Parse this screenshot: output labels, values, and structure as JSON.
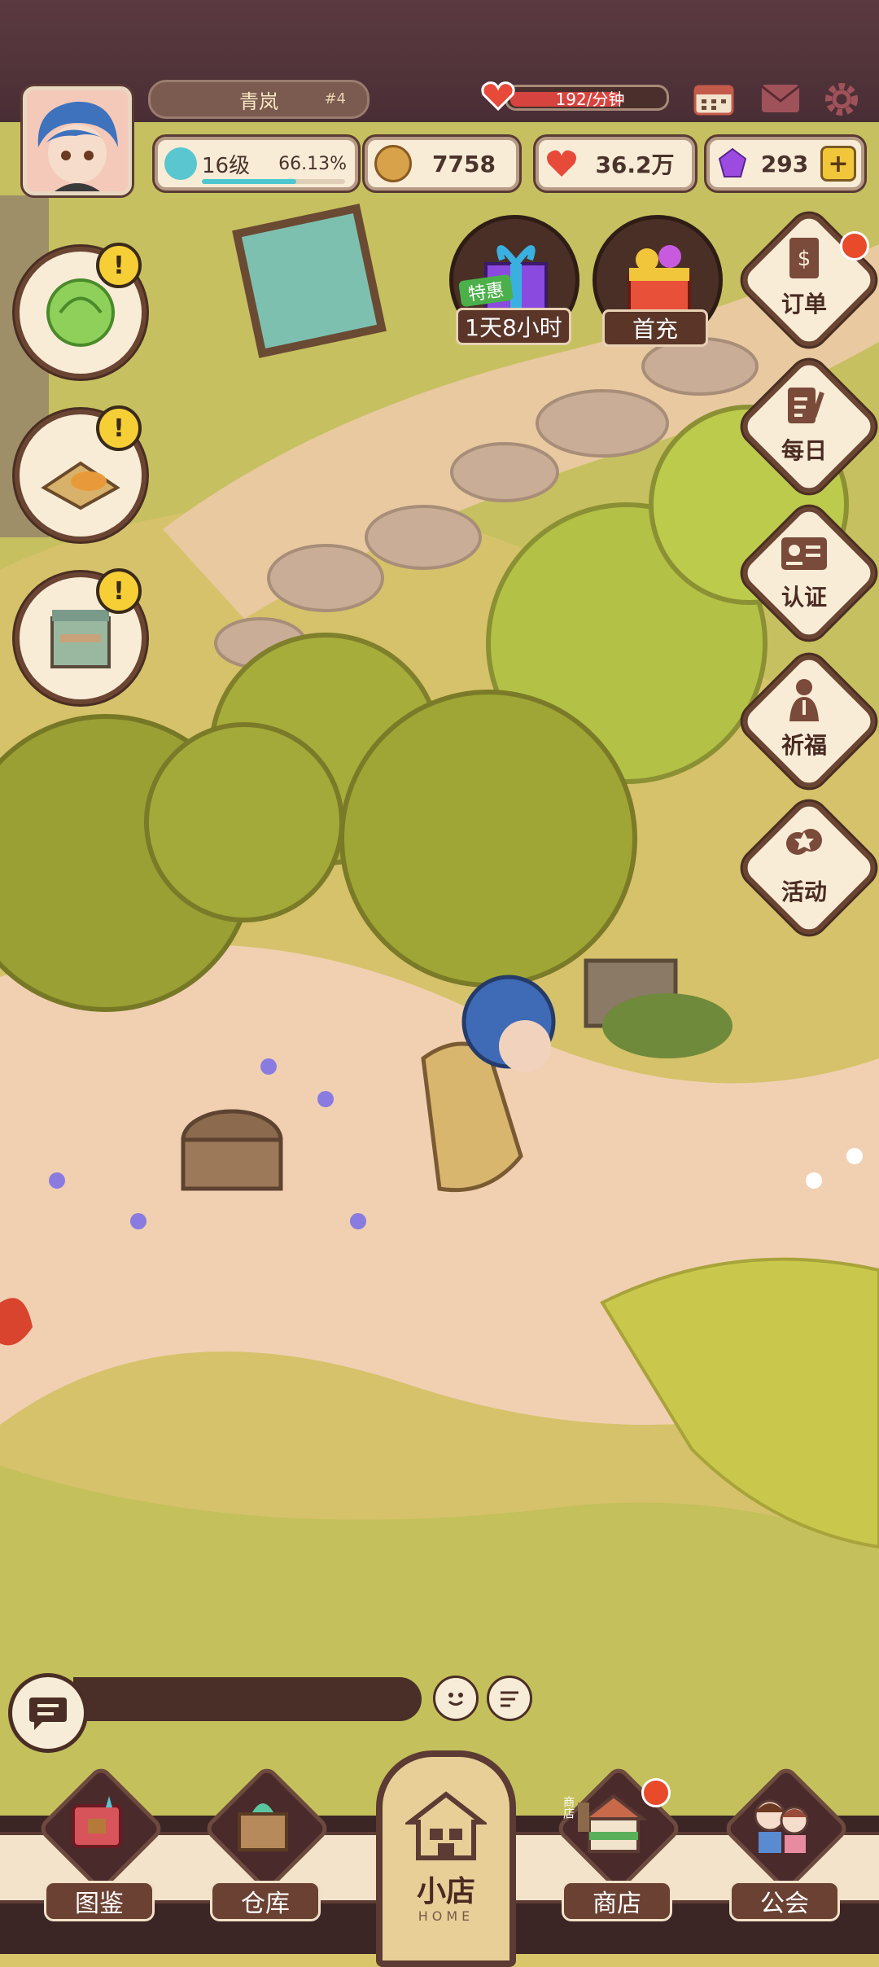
{
  "player": {
    "name": "青岚",
    "rank": "#4",
    "level": "16级",
    "exp_percent": "66.13%",
    "exp_fraction": 0.6613
  },
  "rate": {
    "text": "192/分钟"
  },
  "resources": {
    "coins": "7758",
    "hearts": "36.2万",
    "gems": "293"
  },
  "promos": [
    {
      "name": "special-offer",
      "tag": "特惠",
      "label": "1天8小时"
    },
    {
      "name": "first-recharge",
      "label": "首充"
    }
  ],
  "side_menu": [
    {
      "name": "orders",
      "label": "订单"
    },
    {
      "name": "daily",
      "label": "每日"
    },
    {
      "name": "certify",
      "label": "认证"
    },
    {
      "name": "prayer",
      "label": "祈福"
    },
    {
      "name": "events",
      "label": "活动"
    }
  ],
  "nav": {
    "catalog": "图鉴",
    "warehouse": "仓库",
    "shop_home": "小店",
    "shop_home_sub": "HOME",
    "store": "商店",
    "guild": "公会"
  },
  "store_sign": "商店",
  "colors": {
    "bar": "#4a2e35",
    "accent_red": "#d7443f",
    "cream": "#f8ecd7",
    "brown": "#6b4533",
    "gem": "#9b4be0"
  }
}
